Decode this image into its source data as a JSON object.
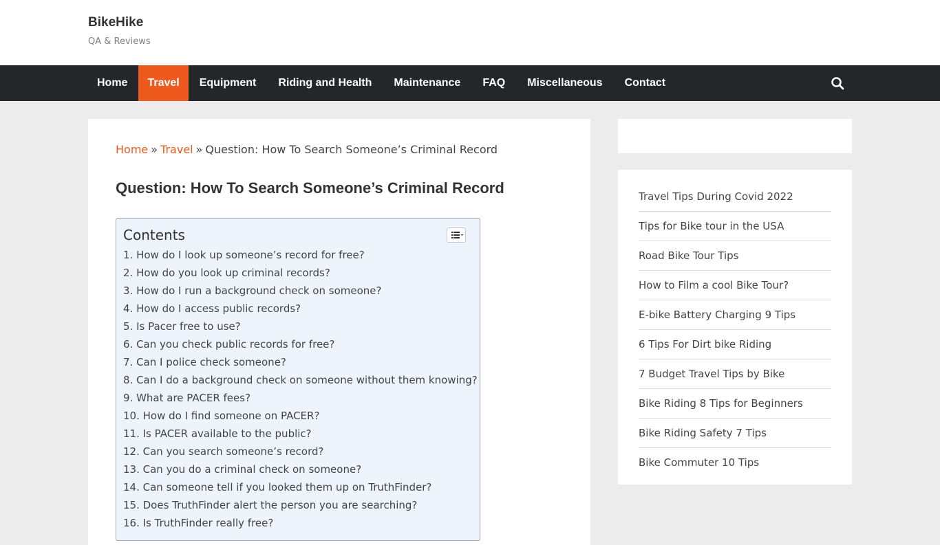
{
  "site": {
    "title": "BikeHike",
    "tagline": "QA & Reviews"
  },
  "nav": {
    "items": [
      {
        "label": "Home"
      },
      {
        "label": "Travel",
        "active": true
      },
      {
        "label": "Equipment"
      },
      {
        "label": "Riding and Health"
      },
      {
        "label": "Maintenance"
      },
      {
        "label": "FAQ"
      },
      {
        "label": "Miscellaneous"
      },
      {
        "label": "Contact"
      }
    ],
    "search_icon": "search-icon",
    "active_color": "#ee5a1e",
    "bar_color": "#23272a"
  },
  "breadcrumb": {
    "home": "Home",
    "sep1": "»",
    "section": "Travel",
    "sep2": "»",
    "current": "Question: How To Search Someone’s Criminal Record"
  },
  "article": {
    "title": "Question: How To Search Someone’s Criminal Record"
  },
  "toc": {
    "title": "Contents",
    "toggle_icon": "list-toggle-icon",
    "items": [
      "1. How do I look up someone’s record for free?",
      "2. How do you look up criminal records?",
      "3. How do I run a background check on someone?",
      "4. How do I access public records?",
      "5. Is Pacer free to use?",
      "6. Can you check public records for free?",
      "7. Can I police check someone?",
      "8. Can I do a background check on someone without them knowing?",
      "9. What are PACER fees?",
      "10. How do I find someone on PACER?",
      "11. Is PACER available to the public?",
      "12. Can you search someone’s record?",
      "13. Can you do a criminal check on someone?",
      "14. Can someone tell if you looked them up on TruthFinder?",
      "15. Does TruthFinder alert the person you are searching?",
      "16. Is TruthFinder really free?"
    ]
  },
  "sidebar": {
    "links": [
      "Travel Tips During Covid 2022",
      "Tips for Bike tour in the USA",
      "Road Bike Tour Tips",
      "How to Film a cool Bike Tour?",
      "E-bike Battery Charging 9 Tips",
      "6 Tips For Dirt bike Riding",
      "7 Budget Travel Tips by Bike",
      "Bike Riding 8 Tips for Beginners",
      "Bike Riding Safety 7 Tips",
      "Bike Commuter 10 Tips"
    ]
  }
}
